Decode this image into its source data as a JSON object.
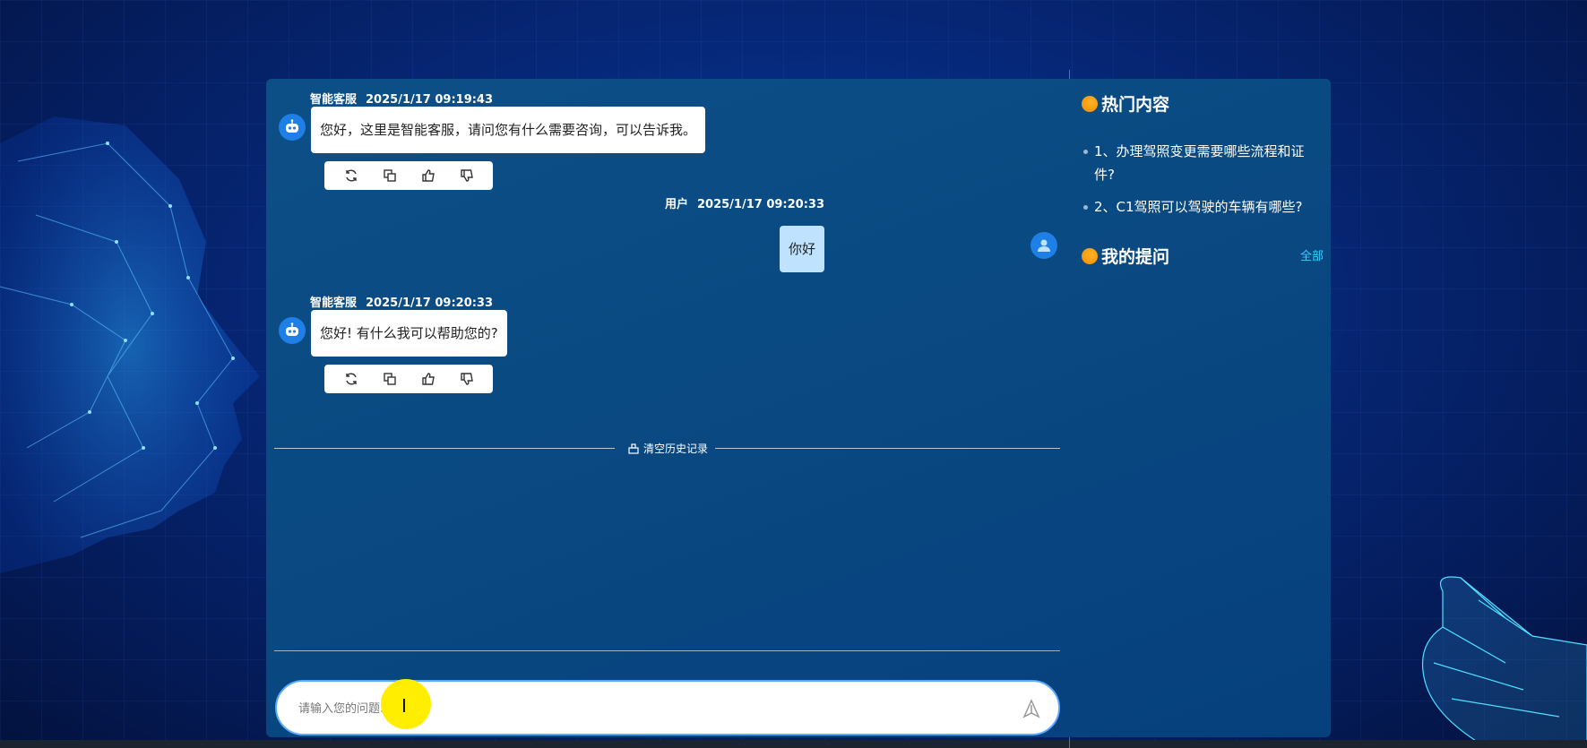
{
  "chat": {
    "messages": [
      {
        "role": "bot",
        "sender": "智能客服",
        "time": "2025/1/17 09:19:43",
        "text": "您好，这里是智能客服，请问您有什么需要咨询，可以告诉我。"
      },
      {
        "role": "user",
        "sender": "用户",
        "time": "2025/1/17 09:20:33",
        "text": "你好"
      },
      {
        "role": "bot",
        "sender": "智能客服",
        "time": "2025/1/17 09:20:33",
        "text": "您好! 有什么我可以帮助您的?"
      }
    ],
    "clear_history_label": "清空历史记录",
    "input_placeholder": "请输入您的问题..."
  },
  "sidebar": {
    "hot_title": "热门内容",
    "hot_items": [
      {
        "text": "1、办理驾照变更需要哪些流程和证件?"
      },
      {
        "text": "2、C1驾照可以驾驶的车辆有哪些?"
      }
    ],
    "my_questions_title": "我的提问",
    "all_link": "全部"
  },
  "icons": {
    "bot_avatar": "robot-icon",
    "user_avatar": "user-icon",
    "actions": [
      "refresh-icon",
      "copy-icon",
      "thumbs-up-icon",
      "thumbs-down-icon"
    ],
    "clear": "broom-icon",
    "send": "send-icon",
    "section": "orange-dot-icon"
  },
  "colors": {
    "accent": "#35d0ff",
    "user_bubble": "#bfe3ff",
    "avatar": "#1e7fe6",
    "section_dot": "#f39a10"
  }
}
